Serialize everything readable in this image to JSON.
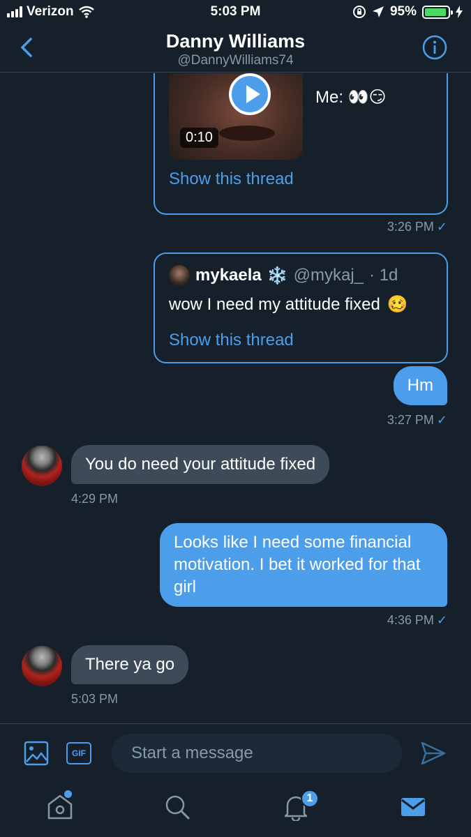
{
  "status_bar": {
    "carrier": "Verizon",
    "time": "5:03 PM",
    "battery": "95%",
    "battery_level": 0.95
  },
  "header": {
    "name": "Danny Williams",
    "handle": "@DannyWilliams74"
  },
  "messages": {
    "video_card": {
      "duration": "0:10",
      "text": "Me: 👀😏",
      "link": "Show this thread",
      "time": "3:26 PM"
    },
    "quote_card": {
      "name": "mykaela",
      "name_emoji": "❄️",
      "handle": "@mykaj_",
      "age": "· 1d",
      "text": "wow I need my attitude fixed",
      "emoji": "🥴",
      "link": "Show this thread"
    },
    "hm": {
      "text": "Hm",
      "time": "3:27 PM"
    },
    "reply1": {
      "text": "You do need your attitude fixed",
      "time": "4:29 PM"
    },
    "outgoing2": {
      "text": "Looks like I need some financial motivation. I bet it worked for that girl",
      "time": "4:36 PM"
    },
    "reply2": {
      "text": "There ya go",
      "time": "5:03 PM"
    },
    "check": "✓"
  },
  "composer": {
    "placeholder": "Start a message",
    "gif_label": "GIF"
  },
  "tabbar": {
    "notifications_count": "1"
  },
  "colors": {
    "background": "#15202b",
    "accent": "#4c9eeb",
    "incoming_bubble": "#3d4b59",
    "muted_text": "#8899a6"
  }
}
